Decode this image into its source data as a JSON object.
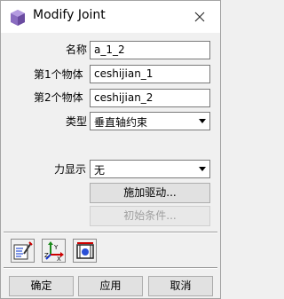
{
  "window": {
    "title": "Modify Joint",
    "app_icon": "cube-icon",
    "close_icon": "close-icon"
  },
  "form": {
    "name_label": "名称",
    "name_value": "a_1_2",
    "body1_label": "第1个物体",
    "body1_value": "ceshijian_1",
    "body2_label": "第2个物体",
    "body2_value": "ceshijian_2",
    "type_label": "类型",
    "type_value": "垂直轴约束",
    "force_label": "力显示",
    "force_value": "无"
  },
  "actions": {
    "apply_drive": "施加驱动...",
    "initial_conditions": "初始条件..."
  },
  "tools": [
    {
      "icon": "edit-properties-icon"
    },
    {
      "icon": "coordinate-axes-icon"
    },
    {
      "icon": "joint-marker-icon"
    }
  ],
  "footer": {
    "ok": "确定",
    "apply": "应用",
    "cancel": "取消"
  },
  "colors": {
    "close_hover": "#f1707a",
    "icon_purple": "#7b5bb0",
    "disabled_text": "#a0a0a0"
  }
}
